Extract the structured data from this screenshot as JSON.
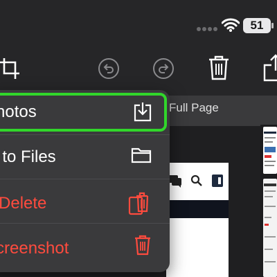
{
  "status": {
    "battery": "51"
  },
  "tabs": {
    "full_page": "Full Page"
  },
  "menu": {
    "items": [
      {
        "label": "Photos",
        "icon": "save-down-icon"
      },
      {
        "label": "F to Files",
        "icon": "folder-icon"
      },
      {
        "label": "d Delete",
        "icon": "copy-delete-icon",
        "destructive": true
      },
      {
        "label": "creenshot",
        "icon": "trash-icon",
        "destructive": true
      }
    ]
  },
  "colors": {
    "accent_green": "#31d62b",
    "destructive_red": "#ff4b3e",
    "menu_bg": "#3a3a3c"
  }
}
